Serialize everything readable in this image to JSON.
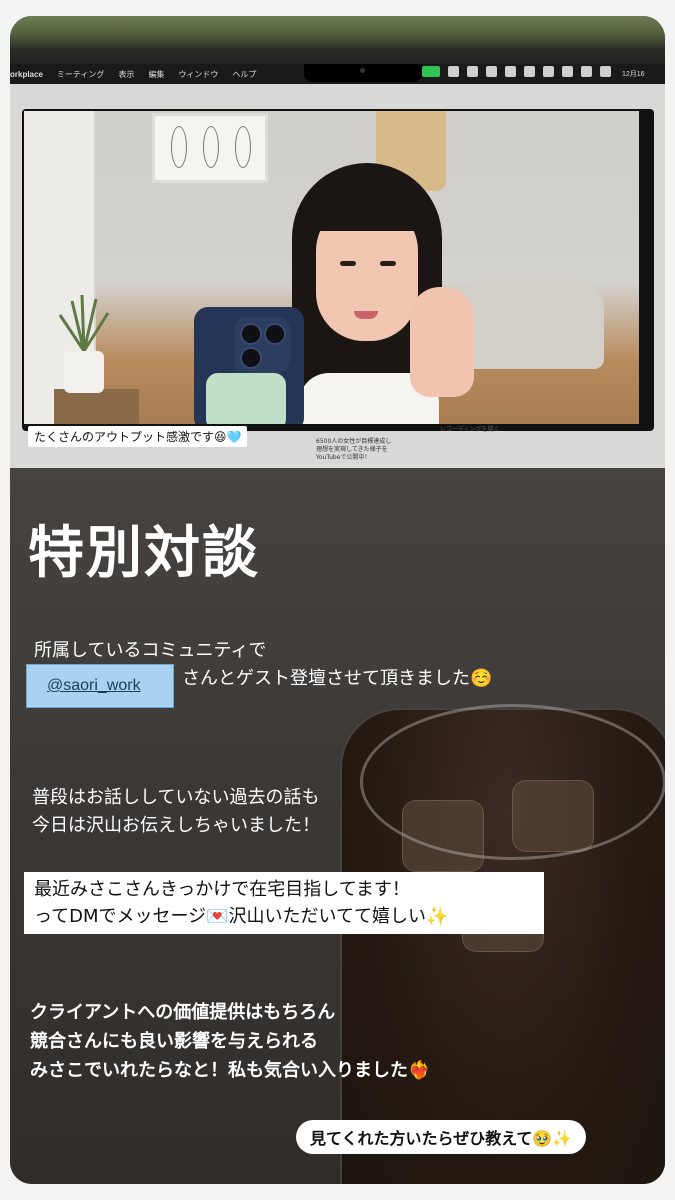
{
  "screen": {
    "app_name": "orkplace",
    "menu_items": [
      "ミーティング",
      "表示",
      "編集",
      "ウィンドウ",
      "ヘルプ"
    ],
    "clock": "12月16",
    "zoom_banner": "6500人の女性が目標達成し理想を実現してきた様子をYouTubeで公開中！",
    "recording_label": "レコーディングを開く",
    "caption": "たくさんのアウトプット感激です😆🩵"
  },
  "story": {
    "title": "特別対談",
    "line1": "所属しているコミュニティで",
    "mention": "@saori_work",
    "line2": "さんとゲスト登壇させて頂きました☺️",
    "para2": [
      "普段はお話ししていない過去の話も",
      "今日は沢山お伝えしちゃいました！"
    ],
    "highlight": [
      "最近みさこさんきっかけで在宅目指してます！",
      "ってDMでメッセージ💌沢山いただいてて嬉しい✨"
    ],
    "para3": [
      "クライアントへの価値提供はもちろん",
      "競合さんにも良い影響を与えられる",
      "みさこでいれたらなと！私も気合い入りました❤️‍🔥"
    ],
    "pill": "見てくれた方いたらぜひ教えて🥹✨"
  }
}
